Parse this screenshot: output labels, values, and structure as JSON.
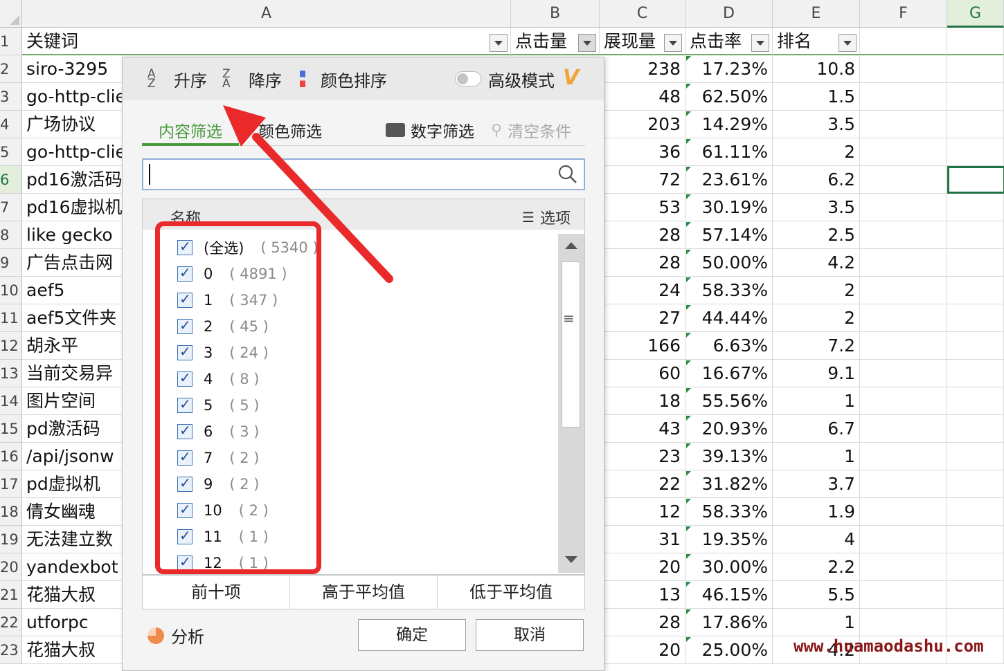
{
  "columns": [
    "A",
    "B",
    "C",
    "D",
    "E",
    "F",
    "G"
  ],
  "header_row": {
    "row_num": "1",
    "A": "关键词",
    "B": "点击量",
    "C": "展现量",
    "D": "点击率",
    "E": "排名"
  },
  "rows": [
    {
      "n": "2",
      "a": "siro-3295",
      "b": "",
      "c": "238",
      "d": "17.23%",
      "e": "10.8"
    },
    {
      "n": "3",
      "a": "go-http-clie",
      "b": "",
      "c": "48",
      "d": "62.50%",
      "e": "1.5"
    },
    {
      "n": "4",
      "a": "广场协议",
      "b": "",
      "c": "203",
      "d": "14.29%",
      "e": "3.5"
    },
    {
      "n": "5",
      "a": "go-http-clie",
      "b": "",
      "c": "36",
      "d": "61.11%",
      "e": "2"
    },
    {
      "n": "6",
      "a": "pd16激活码",
      "b": "",
      "c": "72",
      "d": "23.61%",
      "e": "6.2"
    },
    {
      "n": "7",
      "a": "pd16虚拟机",
      "b": "",
      "c": "53",
      "d": "30.19%",
      "e": "3.5"
    },
    {
      "n": "8",
      "a": "like gecko",
      "b": "",
      "c": "28",
      "d": "57.14%",
      "e": "2.5"
    },
    {
      "n": "9",
      "a": "广告点击网",
      "b": "",
      "c": "28",
      "d": "50.00%",
      "e": "4.2"
    },
    {
      "n": "10",
      "a": "aef5",
      "b": "",
      "c": "24",
      "d": "58.33%",
      "e": "2"
    },
    {
      "n": "11",
      "a": "aef5文件夹",
      "b": "",
      "c": "27",
      "d": "44.44%",
      "e": "2"
    },
    {
      "n": "12",
      "a": "胡永平",
      "b": "",
      "c": "166",
      "d": "6.63%",
      "e": "7.2"
    },
    {
      "n": "13",
      "a": "当前交易异",
      "b": "",
      "c": "60",
      "d": "16.67%",
      "e": "9.1"
    },
    {
      "n": "14",
      "a": "图片空间",
      "b": "",
      "c": "18",
      "d": "55.56%",
      "e": "1"
    },
    {
      "n": "15",
      "a": "pd激活码",
      "b": "",
      "c": "43",
      "d": "20.93%",
      "e": "6.7"
    },
    {
      "n": "16",
      "a": "/api/jsonw",
      "b": "",
      "c": "23",
      "d": "39.13%",
      "e": "1"
    },
    {
      "n": "17",
      "a": "pd虚拟机",
      "b": "",
      "c": "22",
      "d": "31.82%",
      "e": "3.7"
    },
    {
      "n": "18",
      "a": "倩女幽魂",
      "b": "",
      "c": "12",
      "d": "58.33%",
      "e": "1.9"
    },
    {
      "n": "19",
      "a": "无法建立数",
      "b": "",
      "c": "31",
      "d": "19.35%",
      "e": "4"
    },
    {
      "n": "20",
      "a": "yandexbot",
      "b": "",
      "c": "20",
      "d": "30.00%",
      "e": "2.2"
    },
    {
      "n": "21",
      "a": "花猫大叔",
      "b": "",
      "c": "13",
      "d": "46.15%",
      "e": "5.5"
    },
    {
      "n": "22",
      "a": "utforpc",
      "b": "",
      "c": "28",
      "d": "17.86%",
      "e": "1"
    },
    {
      "n": "23",
      "a": "花猫大叔",
      "b": "",
      "c": "20",
      "d": "25.00%",
      "e": "4.2"
    }
  ],
  "filter_popup": {
    "sort_asc": "升序",
    "sort_desc": "降序",
    "sort_color": "颜色排序",
    "advanced_mode": "高级模式",
    "tabs": {
      "content": "内容筛选",
      "color": "颜色筛选",
      "number": "数字筛选",
      "clear": "清空条件"
    },
    "search_placeholder": "",
    "list_header_name": "名称",
    "list_header_options": "选项",
    "items": [
      {
        "label": "(全选)",
        "count": "( 5340 )"
      },
      {
        "label": "0",
        "count": "( 4891 )"
      },
      {
        "label": "1",
        "count": "( 347 )"
      },
      {
        "label": "2",
        "count": "( 45 )"
      },
      {
        "label": "3",
        "count": "( 24 )"
      },
      {
        "label": "4",
        "count": "( 8 )"
      },
      {
        "label": "5",
        "count": "( 5 )"
      },
      {
        "label": "6",
        "count": "( 3 )"
      },
      {
        "label": "7",
        "count": "( 2 )"
      },
      {
        "label": "9",
        "count": "( 2 )"
      },
      {
        "label": "10",
        "count": "( 2 )"
      },
      {
        "label": "11",
        "count": "( 1 )"
      },
      {
        "label": "12",
        "count": "( 1 )"
      }
    ],
    "quick_buttons": [
      "前十项",
      "高于平均值",
      "低于平均值"
    ],
    "analysis": "分析",
    "ok": "确定",
    "cancel": "取消"
  },
  "watermark": "www.huamaodashu.com",
  "colors": {
    "accent_green": "#217346",
    "tab_green": "#4a9a3e",
    "annotation_red": "#ea2a2a"
  }
}
